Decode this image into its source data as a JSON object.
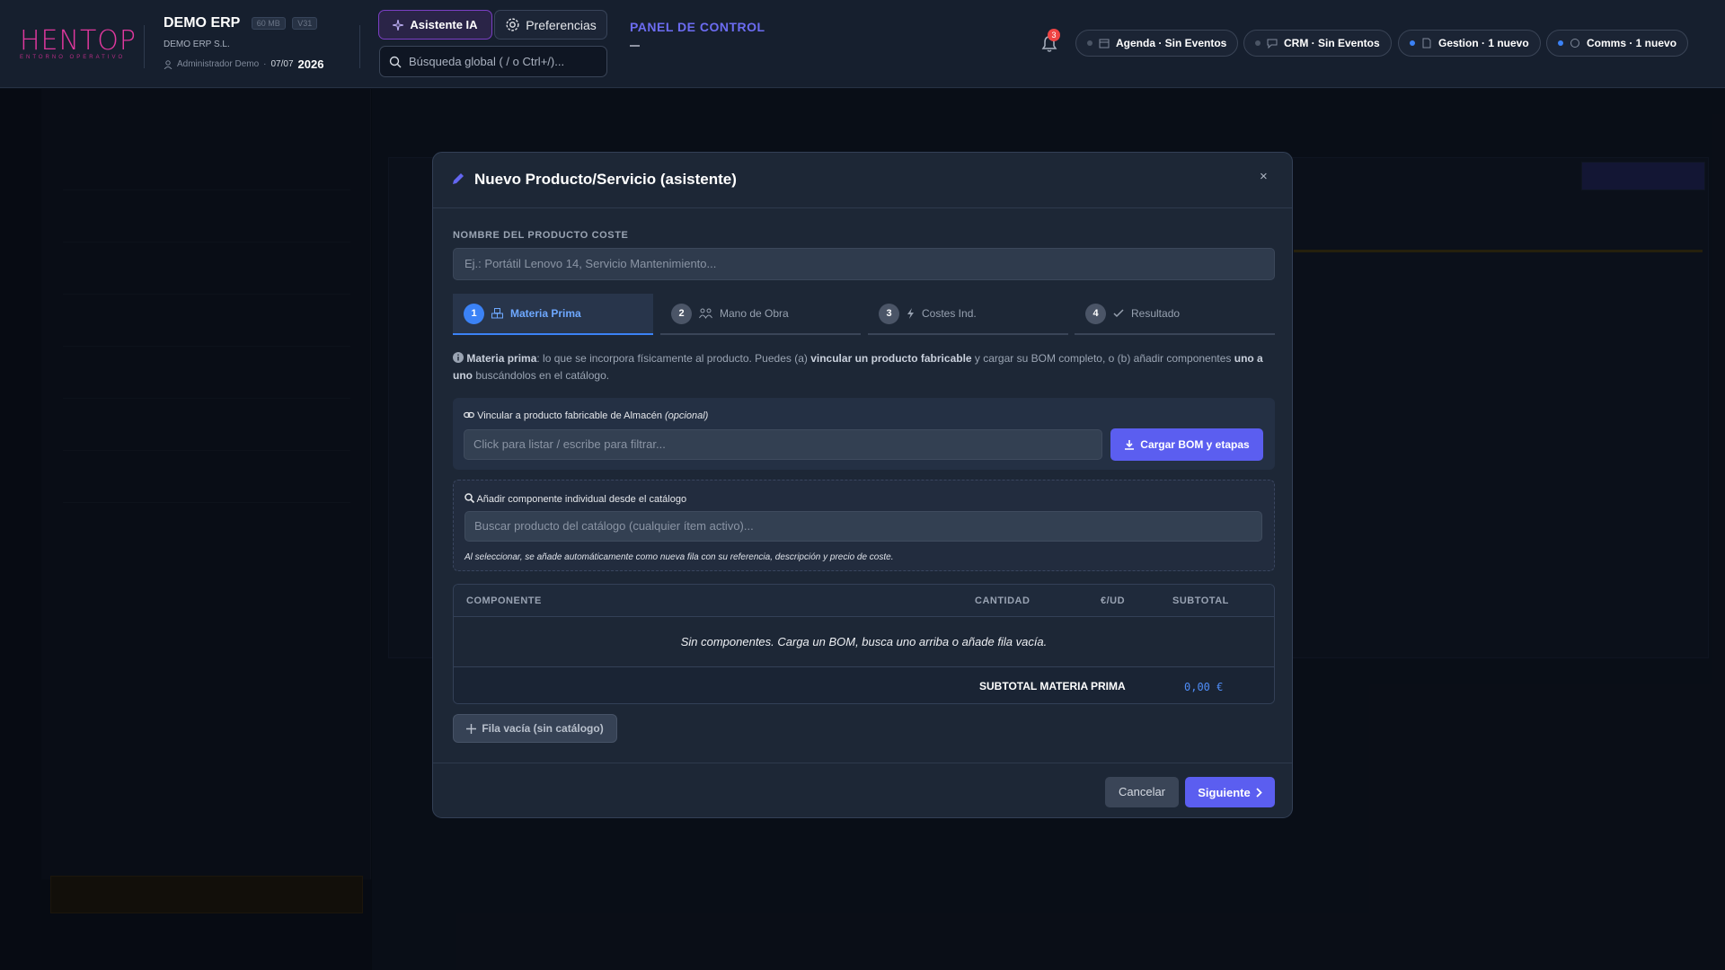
{
  "header": {
    "logo": {
      "wordmark": "HENTOP",
      "tagline": "ENTORNO OPERATIVO"
    },
    "app_name": "DEMO ERP",
    "size_badge": "60 MB",
    "version_badge": "V31",
    "company": "DEMO ERP S.L.",
    "user": "Administrador Demo",
    "date": "07/07",
    "year": "2026",
    "assistant_label": "Asistente IA",
    "preferences_label": "Preferencias",
    "search_placeholder": "Búsqueda global ( / o Ctrl+/)...",
    "panel_title": "PANEL DE CONTROL",
    "notification_count": "3",
    "status_pills": [
      {
        "label": "Agenda · Sin Eventos",
        "icon": "calendar-icon",
        "active": false
      },
      {
        "label": "CRM · Sin Eventos",
        "icon": "chat-icon",
        "active": false
      },
      {
        "label": "Gestion · 1 nuevo",
        "icon": "document-icon",
        "active": true
      },
      {
        "label": "Comms · 1 nuevo",
        "icon": "message-icon",
        "active": true
      }
    ]
  },
  "modal": {
    "title": "Nuevo Producto/Servicio (asistente)",
    "close_glyph": "×",
    "name_label": "NOMBRE DEL PRODUCTO COSTE",
    "name_placeholder": "Ej.: Portátil Lenovo 14, Servicio Mantenimiento...",
    "tabs": [
      {
        "num": "1",
        "label": "Materia Prima",
        "icon": "boxes-icon",
        "active": true
      },
      {
        "num": "2",
        "label": "Mano de Obra",
        "icon": "users-icon",
        "active": false
      },
      {
        "num": "3",
        "label": "Costes Ind.",
        "icon": "bolt-icon",
        "active": false
      },
      {
        "num": "4",
        "label": "Resultado",
        "icon": "check-icon",
        "active": false
      }
    ],
    "info": {
      "term": "Materia prima",
      "text1": ": lo que se incorpora físicamente al producto. Puedes (a) ",
      "bold1": "vincular un producto fabricable",
      "text2": " y cargar su BOM completo, o (b) añadir componentes ",
      "bold2": "uno a uno",
      "text3": " buscándolos en el catálogo."
    },
    "link": {
      "label": "Vincular a producto fabricable de Almacén",
      "optional": "(opcional)",
      "placeholder": "Click para listar / escribe para filtrar...",
      "button": "Cargar BOM y etapas"
    },
    "add": {
      "label": "Añadir componente individual desde el catálogo",
      "placeholder": "Buscar producto del catálogo (cualquier ítem activo)...",
      "note": "Al seleccionar, se añade automáticamente como nueva fila con su referencia, descripción y precio de coste."
    },
    "table": {
      "headers": [
        "COMPONENTE",
        "CANTIDAD",
        "€/UD",
        "SUBTOTAL"
      ],
      "empty": "Sin componentes. Carga un BOM, busca uno arriba o añade fila vacía.",
      "subtotal_label": "SUBTOTAL MATERIA PRIMA",
      "subtotal_value": "0,00 €"
    },
    "empty_row_button": "Fila vacía (sin catálogo)",
    "cancel": "Cancelar",
    "next": "Siguiente"
  },
  "colors": {
    "accent": "#5b5ef0",
    "active_tab": "#3b82f6",
    "brand": "#e0389e",
    "badge": "#ef4444"
  }
}
